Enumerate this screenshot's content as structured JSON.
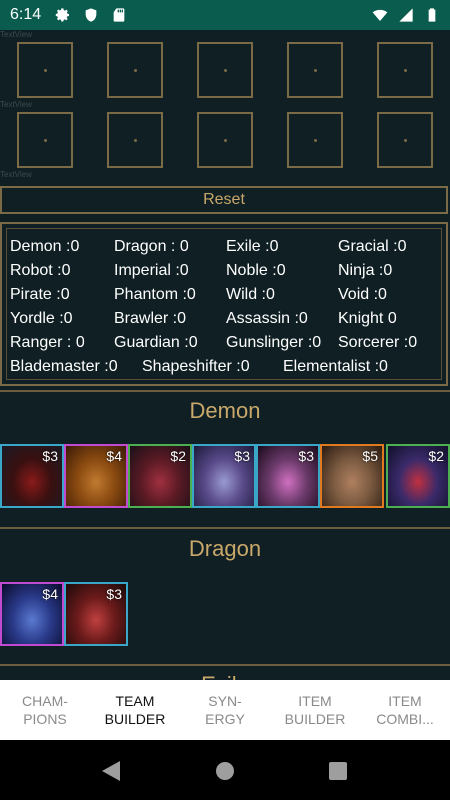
{
  "status_bar": {
    "time": "6:14",
    "left_icons": [
      "gear-icon",
      "shield-icon",
      "sd-card-icon"
    ],
    "right_icons": [
      "wifi-icon",
      "signal-icon",
      "battery-icon"
    ]
  },
  "debug_labels": [
    "TextView",
    "TextView",
    "TextView"
  ],
  "team_slots": {
    "rows": 2,
    "per_row": 5
  },
  "reset_label": "Reset",
  "synergies": [
    [
      "Demon :0",
      "Dragon : 0",
      "Exile :0",
      "Gracial :0"
    ],
    [
      "Robot :0",
      "Imperial :0",
      "Noble :0",
      "Ninja :0"
    ],
    [
      "Pirate :0",
      "Phantom  :0",
      "Wild :0",
      "Void :0"
    ],
    [
      "Yordle :0",
      "Brawler :0",
      "Assassin :0",
      "Knight 0"
    ],
    [
      "Ranger : 0",
      "Guardian :0",
      "Gunslinger :0",
      "Sorcerer :0"
    ],
    [
      "Blademaster :0",
      "Shapeshifter :0",
      "Elementalist :0"
    ]
  ],
  "sections": [
    {
      "title": "Demon",
      "champions": [
        {
          "cost": "$3",
          "border": "#3aa7c9",
          "art": [
            "#3a1010",
            "#1a1a24",
            "#8a1a1a"
          ]
        },
        {
          "cost": "$4",
          "border": "#c04ad0",
          "art": [
            "#8a4a10",
            "#3a1a08",
            "#c07a30"
          ]
        },
        {
          "cost": "$2",
          "border": "#4cb050",
          "art": [
            "#5a1a24",
            "#1a1018",
            "#a03040"
          ]
        },
        {
          "cost": "$3",
          "border": "#3aa7c9",
          "art": [
            "#5a4a8a",
            "#1a1a3a",
            "#9a9ad0"
          ]
        },
        {
          "cost": "$3",
          "border": "#3aa7c9",
          "art": [
            "#6a3a6a",
            "#1a0a1a",
            "#d070c0"
          ]
        },
        {
          "cost": "$5",
          "border": "#e07a20",
          "art": [
            "#7a5a40",
            "#2a1a10",
            "#b08060"
          ]
        },
        {
          "cost": "$2",
          "border": "#4cb050",
          "art": [
            "#3a2a6a",
            "#10102a",
            "#c03040"
          ]
        }
      ]
    },
    {
      "title": "Dragon",
      "champions": [
        {
          "cost": "$4",
          "border": "#c04ad0",
          "art": [
            "#2a3a8a",
            "#0a0a2a",
            "#5a7ad0"
          ]
        },
        {
          "cost": "$3",
          "border": "#3aa7c9",
          "art": [
            "#6a1a1a",
            "#1a0a0a",
            "#c04040"
          ]
        }
      ]
    },
    {
      "title": "Exile",
      "champions": []
    }
  ],
  "bottom_nav": [
    {
      "label": "CHAM-\nPIONS",
      "active": false
    },
    {
      "label": "TEAM\nBUILDER",
      "active": true
    },
    {
      "label": "SYN-\nERGY",
      "active": false
    },
    {
      "label": "ITEM\nBUILDER",
      "active": false
    },
    {
      "label": "ITEM\nCOMBI...",
      "active": false
    }
  ]
}
